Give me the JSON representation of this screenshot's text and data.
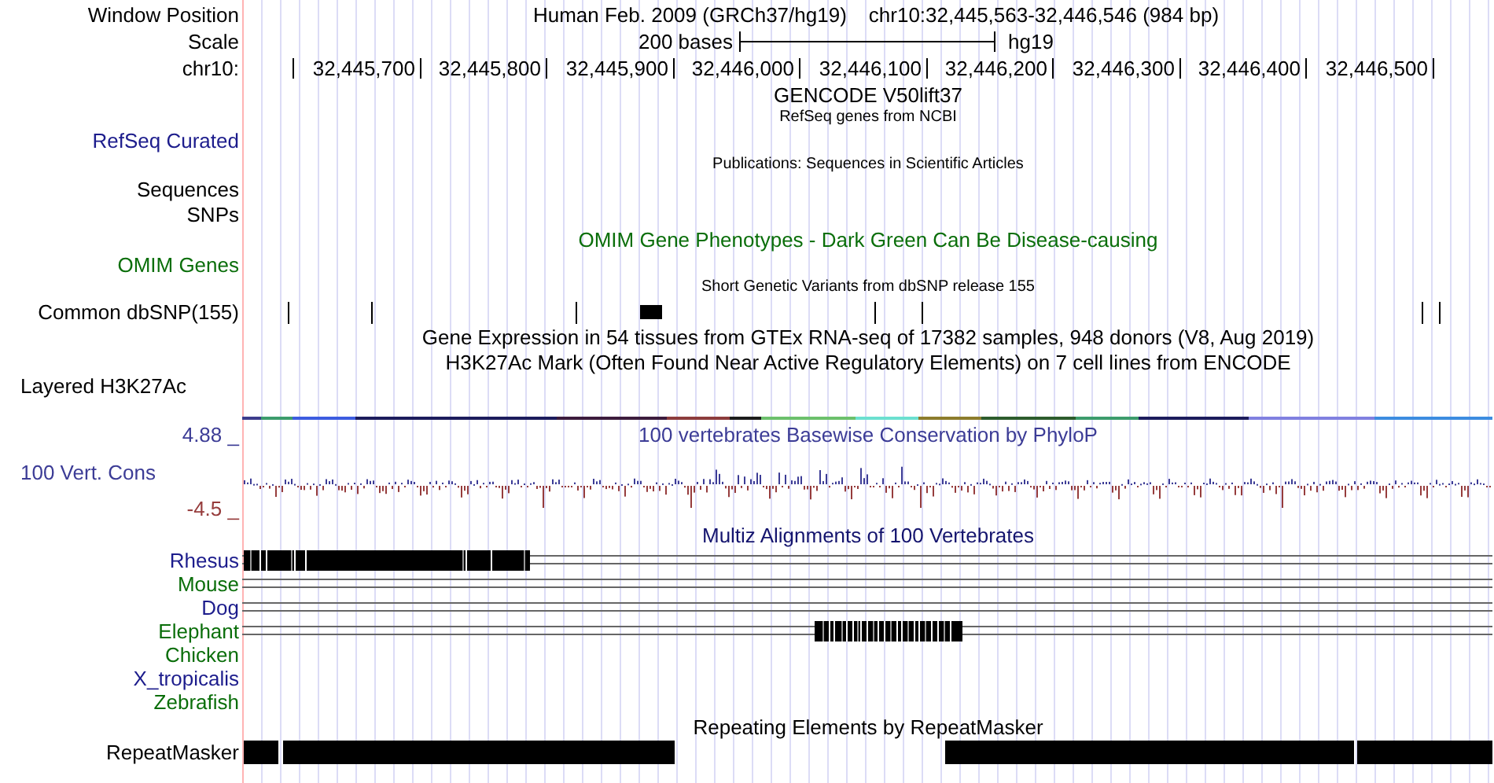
{
  "header": {
    "position_label": "Window Position",
    "assembly": "Human Feb. 2009 (GRCh37/hg19)",
    "position": "chr10:32,445,563-32,446,546 (984 bp)",
    "scale_label": "Scale",
    "scale_text": "200 bases",
    "scale_db": "hg19",
    "chrom_label": "chr10:",
    "ruler_labels": [
      "32,445,700",
      "32,445,800",
      "32,445,900",
      "32,446,000",
      "32,446,100",
      "32,446,200",
      "32,446,300",
      "32,446,400",
      "32,446,500"
    ]
  },
  "tracks": [
    {
      "kind": "gene",
      "title": "GENCODE V50lift37",
      "subtitle": "RefSeq genes from NCBI",
      "label": "RefSeq Curated",
      "color": "#1c1c8c"
    },
    {
      "kind": "pubs",
      "subtitle": "Publications: Sequences in Scientific Articles",
      "labels": [
        "Sequences",
        "SNPs"
      ],
      "color": "#000000"
    },
    {
      "kind": "omim",
      "title": "OMIM Gene Phenotypes - Dark Green Can Be Disease-causing",
      "label": "OMIM Genes",
      "color": "#0a6e0a"
    },
    {
      "kind": "snp",
      "subtitle": "Short Genetic Variants from dbSNP release 155",
      "label": "Common dbSNP(155)",
      "color": "#000000"
    },
    {
      "kind": "text",
      "title": "Gene Expression in 54 tissues from GTEx RNA-seq of 17382 samples, 948 donors (V8, Aug 2019)"
    },
    {
      "kind": "h3k27",
      "title": "H3K27Ac Mark (Often Found Near Active Regulatory Elements) on 7 cell lines from ENCODE",
      "label": "Layered H3K27Ac",
      "color": "#000000"
    },
    {
      "kind": "cons",
      "title": "100 vertebrates Basewise Conservation by PhyloP",
      "label": "100 Vert. Cons",
      "max": "4.88 _",
      "min": "-4.5 _",
      "color": "#3c3c96"
    },
    {
      "kind": "multiz",
      "title": "Multiz Alignments of 100 Vertebrates",
      "species": [
        {
          "name": "Rhesus",
          "color": "#1c1c8c",
          "aligned": true
        },
        {
          "name": "Mouse",
          "color": "#0a6e0a",
          "aligned": true
        },
        {
          "name": "Dog",
          "color": "#1c1c8c",
          "aligned": true
        },
        {
          "name": "Elephant",
          "color": "#0a6e0a",
          "aligned": true
        },
        {
          "name": "Chicken",
          "color": "#0a6e0a",
          "aligned": false
        },
        {
          "name": "X_tropicalis",
          "color": "#1c1c8c",
          "aligned": false
        },
        {
          "name": "Zebrafish",
          "color": "#0a6e0a",
          "aligned": false
        }
      ]
    },
    {
      "kind": "rmsk",
      "title": "Repeating Elements by RepeatMasker",
      "label": "RepeatMasker",
      "color": "#000000"
    }
  ]
}
